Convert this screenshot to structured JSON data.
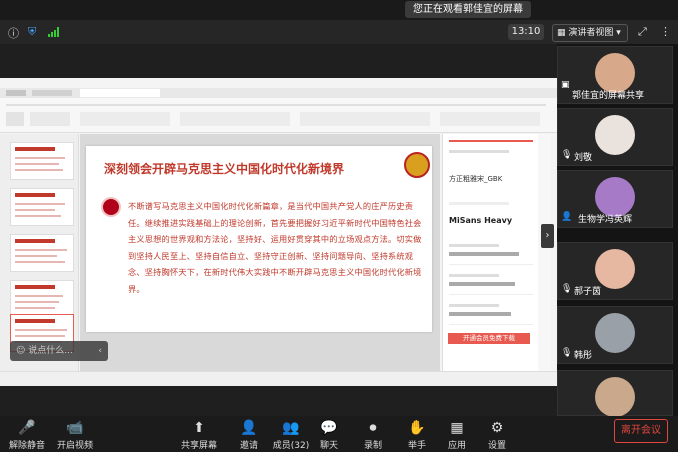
{
  "top": {
    "sharing_banner": "您正在观看郭佳宜的屏幕",
    "time": "13:10",
    "view_mode": "演讲者视图"
  },
  "slide": {
    "title": "深刻领会开辟马克思主义中国化时代化新境界",
    "body": "不断谱写马克思主义中国化时代化新篇章，是当代中国共产党人的庄严历史责任。继续推进实践基础上的理论创新，首先要把握好习近平新时代中国特色社会主义思想的世界观和方法论，坚持好、运用好贯穿其中的立场观点方法。切实做到坚持人民至上、坚持自信自立、坚持守正创新、坚持问题导向、坚持系统观念、坚持胸怀天下，在新时代伟大实践中不断开辟马克思主义中国化时代化新境界。"
  },
  "right_panel": {
    "font_name": "方正粗雅宋_GBK",
    "font_sample": "MiSans Heavy",
    "apply_label": "开通会员免费下载"
  },
  "comment_placeholder": "说点什么...",
  "participants": [
    {
      "name": "郭佳宜的屏幕共享",
      "avatar_color": "#d8a88a"
    },
    {
      "name": "刘敬",
      "avatar_color": "#e9e2dd"
    },
    {
      "name": "生物学冯英辉",
      "avatar_color": "#a77ac8"
    },
    {
      "name": "郝子茵",
      "avatar_color": "#e6b8a2"
    },
    {
      "name": "韩彤",
      "avatar_color": "#9aa0a8"
    },
    {
      "name": "",
      "avatar_color": "#c9a88c"
    }
  ],
  "toolbar": [
    {
      "label": "解除静音",
      "icon": "mic-off-icon",
      "glyph": "🎤"
    },
    {
      "label": "开启视频",
      "icon": "video-off-icon",
      "glyph": "📹"
    },
    {
      "label": "共享屏幕",
      "icon": "share-screen-icon",
      "glyph": "⬆"
    },
    {
      "label": "邀请",
      "icon": "invite-icon",
      "glyph": "👤"
    },
    {
      "label": "成员(32)",
      "icon": "members-icon",
      "glyph": "👥"
    },
    {
      "label": "聊天",
      "icon": "chat-icon",
      "glyph": "💬"
    },
    {
      "label": "录制",
      "icon": "record-icon",
      "glyph": "⏺"
    },
    {
      "label": "举手",
      "icon": "raise-hand-icon",
      "glyph": "✋"
    },
    {
      "label": "应用",
      "icon": "apps-icon",
      "glyph": "▦"
    },
    {
      "label": "设置",
      "icon": "settings-icon",
      "glyph": "⚙"
    }
  ],
  "leave_label": "离开会议",
  "colors": {
    "slide_red": "#c0392b",
    "leave_red": "#e0463c"
  }
}
